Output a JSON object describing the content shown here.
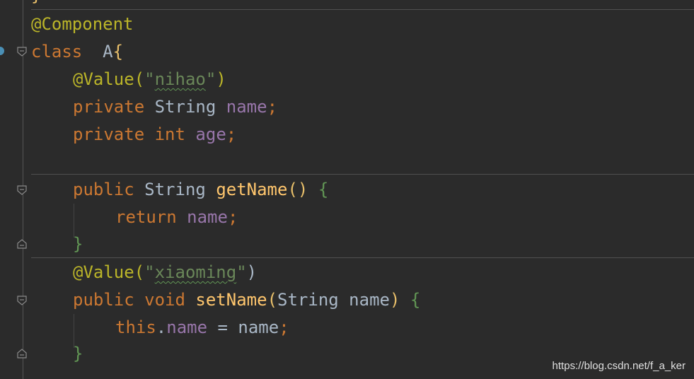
{
  "code": {
    "line_top_fragment": "}",
    "l1_annotation": "@Component",
    "l2_keyword": "class",
    "l2_name": "A",
    "l2_brace": "{",
    "l3_annotation": "@Value(",
    "l3_string_open": "\"",
    "l3_string_value": "nihao",
    "l3_string_close": "\"",
    "l3_close": ")",
    "l4_keyword": "private",
    "l4_type": "String",
    "l4_field": "name",
    "l4_semicolon": ";",
    "l5_keyword": "private",
    "l5_type": "int",
    "l5_field": "age",
    "l5_semicolon": ";",
    "l7_keyword": "public",
    "l7_type": "String",
    "l7_method": "getName",
    "l7_parens": "()",
    "l7_brace": "{",
    "l8_keyword": "return",
    "l8_field": "name",
    "l8_semicolon": ";",
    "l9_brace": "}",
    "l10_annotation": "@Value(",
    "l10_string_open": "\"",
    "l10_string_value": "xiaoming",
    "l10_string_close": "\"",
    "l10_close": ")",
    "l11_keyword": "public",
    "l11_void": "void",
    "l11_method": "setName",
    "l11_paren_open": "(",
    "l11_param_type": "String",
    "l11_param_name": "name",
    "l11_paren_close": ")",
    "l11_brace": "{",
    "l12_this": "this",
    "l12_dot": ".",
    "l12_field": "name",
    "l12_assign": " = ",
    "l12_value": "name",
    "l12_semicolon": ";",
    "l13_brace": "}"
  },
  "watermark": "https://blog.csdn.net/f_a_ker",
  "colors": {
    "background": "#2b2b2b",
    "keyword": "#cc7832",
    "annotation": "#bbb529",
    "string": "#6a8759",
    "field": "#9876aa",
    "method": "#ffc66d",
    "text": "#a9b7c6"
  },
  "gutter_icons": [
    "bean-marker-icon",
    "fold-open-icon",
    "fold-close-icon"
  ]
}
